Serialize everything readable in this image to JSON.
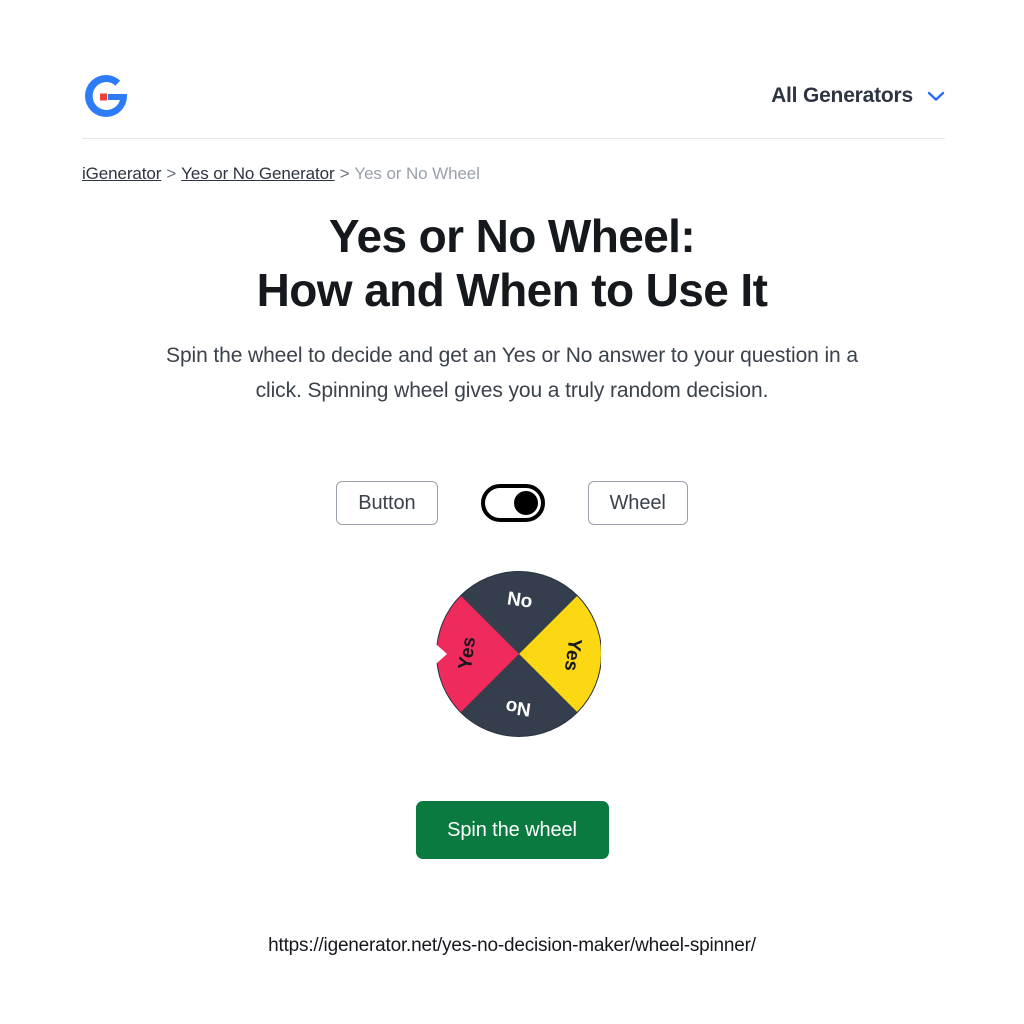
{
  "header": {
    "logo_icon": "igenerator-g-logo-icon",
    "logo_colors": {
      "letter": "#2e7bf6",
      "accent": "#ea4335"
    },
    "nav_label": "All Generators",
    "chevron_icon": "chevron-down-icon",
    "chevron_color": "#2e6bf6"
  },
  "breadcrumb": {
    "separator": ">",
    "items": [
      {
        "label": "iGenerator",
        "muted": false
      },
      {
        "label": "Yes or No Generator",
        "muted": false
      },
      {
        "label": "Yes or No Wheel",
        "muted": true
      }
    ]
  },
  "title": {
    "line1": "Yes or No Wheel:",
    "line2": "How and When to Use It"
  },
  "intro": {
    "text": "Spin the wheel to decide and get an Yes or No answer to your question in a click. Spinning wheel gives you a truly random decision."
  },
  "mode_selector": {
    "left_label": "Button",
    "right_label": "Wheel",
    "toggle_state": "right",
    "selected": "Wheel"
  },
  "wheel": {
    "pointer_icon": "wheel-pointer-icon",
    "colors": {
      "navy": "#343e4c",
      "yellow": "#fbd714",
      "pink": "#ef2a5d",
      "rim": "#2b333f"
    },
    "segments": [
      {
        "position": "top",
        "label": "No",
        "color": "#343e4c",
        "text_color": "#ffffff"
      },
      {
        "position": "right",
        "label": "Yes",
        "color": "#fbd714",
        "text_color": "#15181d"
      },
      {
        "position": "bottom",
        "label": "No",
        "color": "#343e4c",
        "text_color": "#ffffff"
      },
      {
        "position": "left",
        "label": "Yes",
        "color": "#ef2a5d",
        "text_color": "#15181d"
      }
    ]
  },
  "spin_button": {
    "label": "Spin the wheel",
    "color": "#0b7a40"
  },
  "url": {
    "text": "https://igenerator.net/yes-no-decision-maker/wheel-spinner/"
  }
}
